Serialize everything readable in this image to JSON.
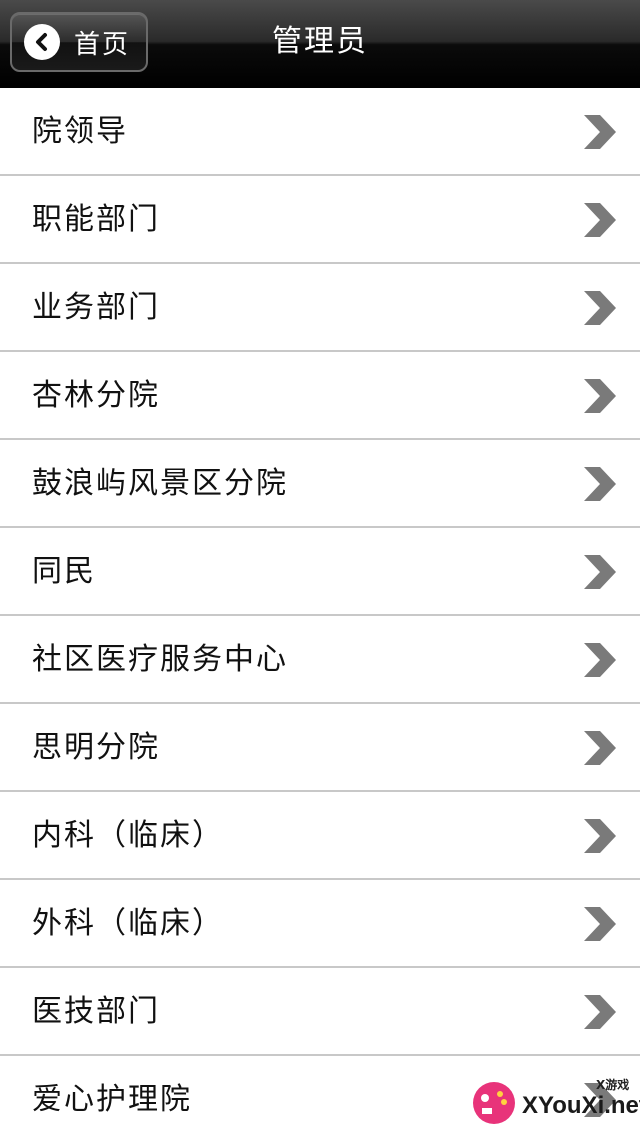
{
  "navbar": {
    "back_label": "首页",
    "title": "管理员"
  },
  "list_items": [
    "院领导",
    "职能部门",
    "业务部门",
    "杏林分院",
    "鼓浪屿风景区分院",
    "同民",
    "社区医疗服务中心",
    "思明分院",
    "内科（临床）",
    "外科（临床）",
    "医技部门",
    "爱心护理院"
  ],
  "watermark": {
    "small_text": "X游戏",
    "site": "XYouXi.net"
  },
  "colors": {
    "navbar": "#000000",
    "divider": "#c8c8c8",
    "chevron": "#7a7a7a",
    "text": "#111111"
  },
  "icons": {
    "back": "chevron-left-circle-icon",
    "row": "chevron-right-icon"
  }
}
